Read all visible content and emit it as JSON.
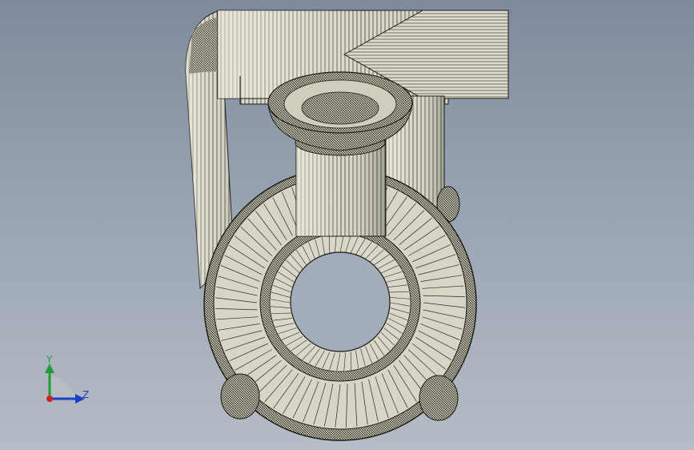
{
  "viewport": {
    "background_top": "#7f8b9c",
    "background_bottom": "#b6bcc6"
  },
  "model": {
    "surface_color": "#d8d7c8",
    "mesh_color": "#1a1a14",
    "hole_color": "#a3acb9"
  },
  "triad": {
    "y_label": "Y",
    "z_label": "Z",
    "y_color": "#1e9b3a",
    "z_color": "#1d3fc2",
    "origin_color": "#d42020"
  }
}
